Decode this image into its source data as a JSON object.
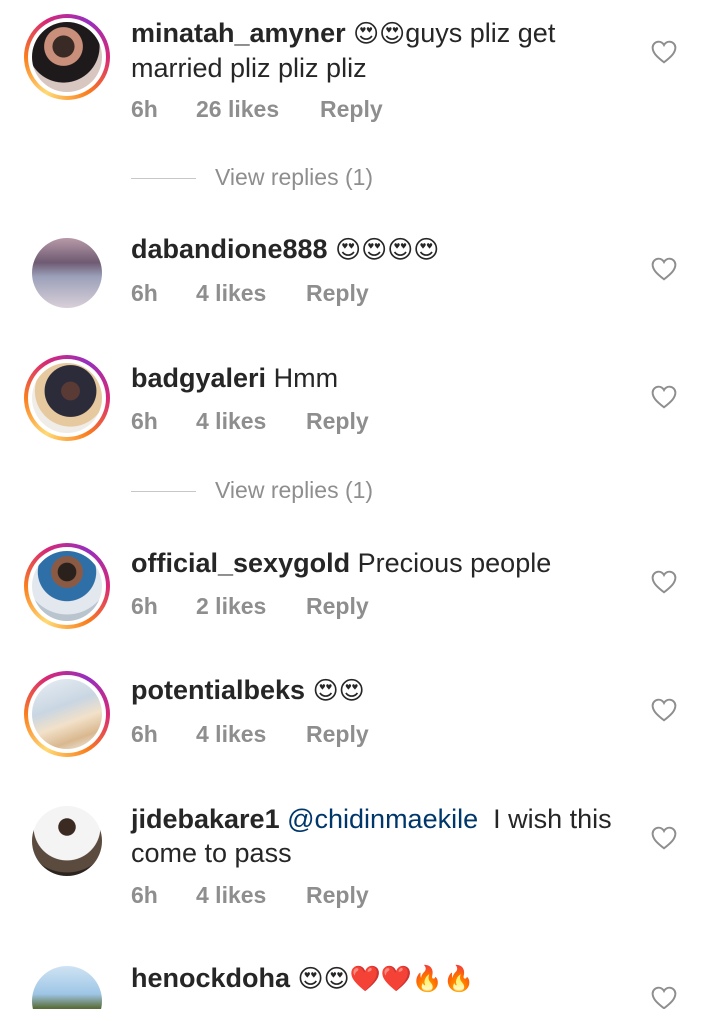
{
  "comments": [
    {
      "username": "minatah_amyner",
      "emoji_prefix": "😍😍",
      "text": "guys pliz get married pliz pliz pliz",
      "time": "6h",
      "likes": "26 likes",
      "reply": "Reply",
      "view_replies": "View replies (1)"
    },
    {
      "username": "dabandione888",
      "emoji_prefix": "😍😍😍😍",
      "text": "",
      "time": "6h",
      "likes": "4 likes",
      "reply": "Reply"
    },
    {
      "username": "badgyaleri",
      "text": "Hmm",
      "time": "6h",
      "likes": "4 likes",
      "reply": "Reply",
      "view_replies": "View replies (1)"
    },
    {
      "username": "official_sexygold",
      "text": "Precious people",
      "time": "6h",
      "likes": "2 likes",
      "reply": "Reply"
    },
    {
      "username": "potentialbeks",
      "emoji_prefix": "😍😍",
      "text": "",
      "time": "6h",
      "likes": "4 likes",
      "reply": "Reply"
    },
    {
      "username": "jidebakare1",
      "mention": "@chidinmaekile",
      "text": "I wish this come to pass",
      "time": "6h",
      "likes": "4 likes",
      "reply": "Reply"
    },
    {
      "username": "henockdoha",
      "emoji_prefix": "😍😍❤️❤️🔥🔥",
      "text": ""
    }
  ],
  "icons": {
    "like": "heart-outline-icon"
  },
  "colors": {
    "username": "#262626",
    "meta": "#8e8e8e",
    "mention": "#00376b",
    "story_ring": "#d62976"
  }
}
